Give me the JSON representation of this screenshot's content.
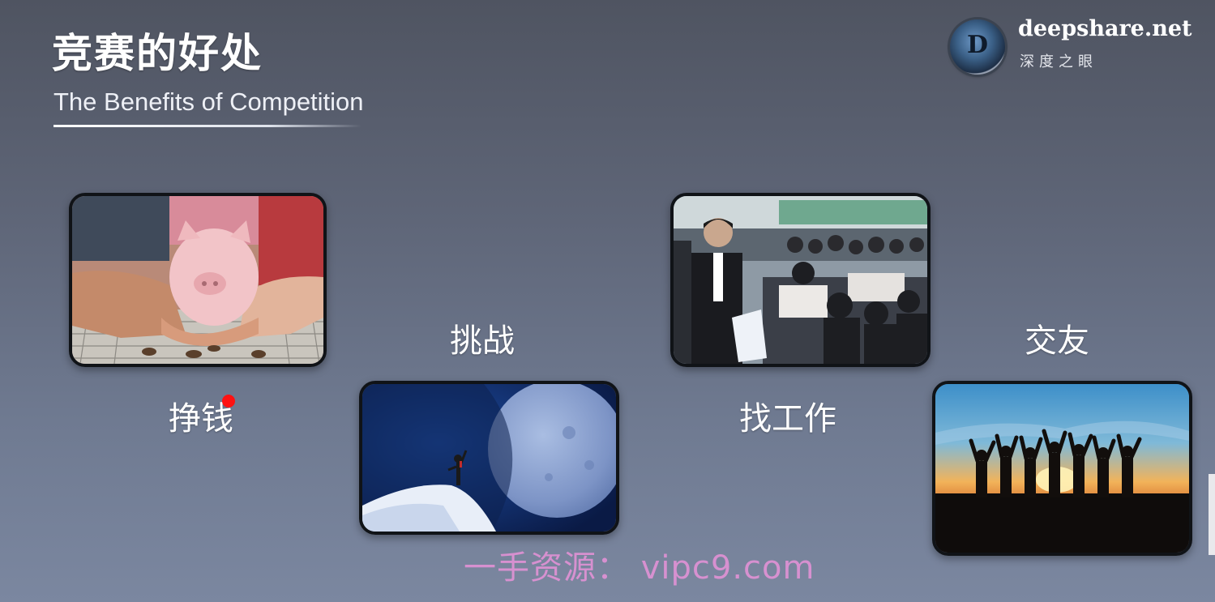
{
  "slide": {
    "title": "竞赛的好处",
    "subtitle": "The Benefits of Competition"
  },
  "logo": {
    "emblem_letter": "D",
    "name": "deepshare.net",
    "tagline": "深度之眼"
  },
  "benefits": [
    {
      "label": "挣钱",
      "image_icon": "piggy-bank-photo"
    },
    {
      "label": "挑战",
      "image_icon": "climber-moon-photo"
    },
    {
      "label": "找工作",
      "image_icon": "job-fair-photo"
    },
    {
      "label": "交友",
      "image_icon": "friends-sunset-photo"
    }
  ],
  "watermark": "一手资源： vipc9.com",
  "colors": {
    "background_top": "#4f5461",
    "background_bottom": "#7b87a0",
    "card_border": "#101317",
    "pointer_dot": "#ff1111",
    "watermark": "#ff96e6"
  }
}
